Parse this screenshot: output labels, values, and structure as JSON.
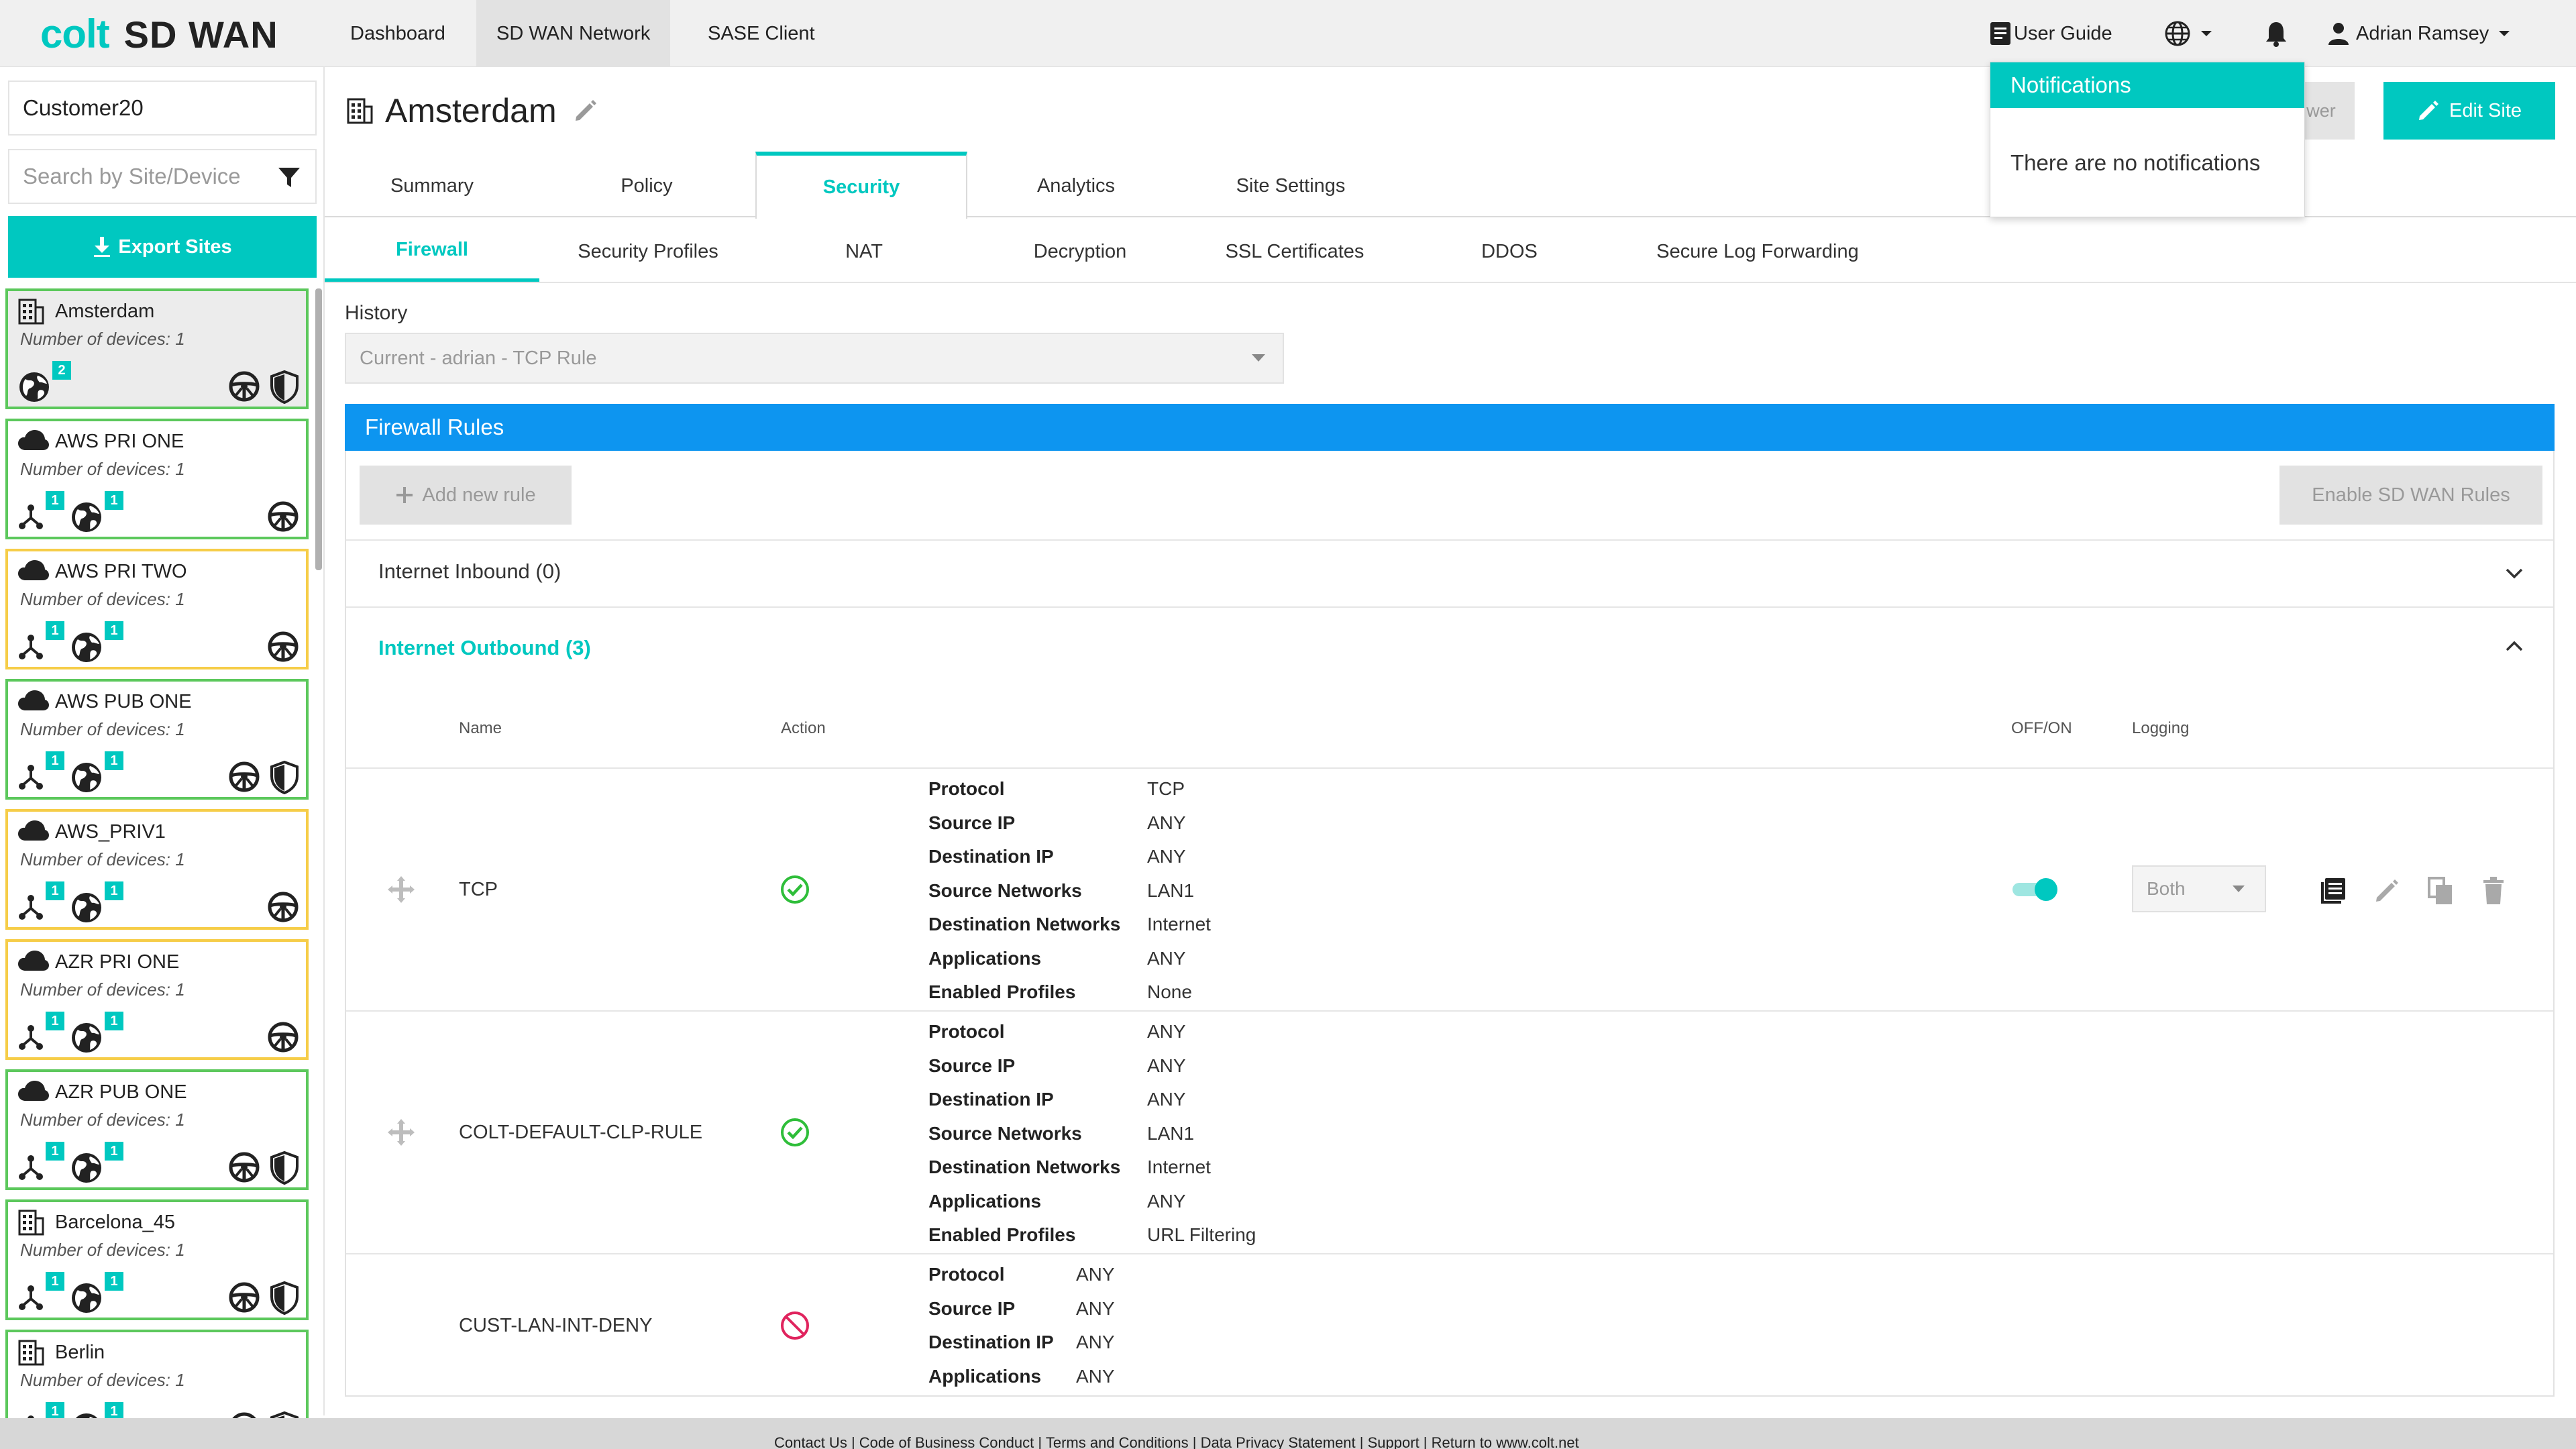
{
  "header": {
    "logo_colt": "colt",
    "logo_product": "SD WAN",
    "nav": [
      "Dashboard",
      "SD WAN Network",
      "SASE Client"
    ],
    "active_nav": "SD WAN Network",
    "user_guide": "User Guide",
    "user_name": "Adrian Ramsey"
  },
  "notifications": {
    "title": "Notifications",
    "empty": "There are no notifications"
  },
  "sidebar": {
    "customer": "Customer20",
    "search_placeholder": "Search by Site/Device",
    "export_label": "Export Sites",
    "sites": [
      {
        "name": "Amsterdam",
        "devices": "Number of devices: 1",
        "status": "green",
        "icon": "building-icon",
        "badges": [
          {
            "icon": "globe-icon",
            "count": "2"
          }
        ],
        "actions": [
          "steering-wheel-icon",
          "shield-icon"
        ],
        "selected": true
      },
      {
        "name": "AWS PRI ONE",
        "devices": "Number of devices: 1",
        "status": "green",
        "icon": "cloud-icon",
        "badges": [
          {
            "icon": "network-icon",
            "count": "1"
          },
          {
            "icon": "globe-icon",
            "count": "1"
          }
        ],
        "actions": [
          "steering-wheel-icon"
        ]
      },
      {
        "name": "AWS PRI TWO",
        "devices": "Number of devices: 1",
        "status": "yellow",
        "icon": "cloud-icon",
        "badges": [
          {
            "icon": "network-icon",
            "count": "1"
          },
          {
            "icon": "globe-icon",
            "count": "1"
          }
        ],
        "actions": [
          "steering-wheel-icon"
        ]
      },
      {
        "name": "AWS PUB ONE",
        "devices": "Number of devices: 1",
        "status": "green",
        "icon": "cloud-icon",
        "badges": [
          {
            "icon": "network-icon",
            "count": "1"
          },
          {
            "icon": "globe-icon",
            "count": "1"
          }
        ],
        "actions": [
          "steering-wheel-icon",
          "shield-icon"
        ]
      },
      {
        "name": "AWS_PRIV1",
        "devices": "Number of devices: 1",
        "status": "yellow",
        "icon": "cloud-icon",
        "badges": [
          {
            "icon": "network-icon",
            "count": "1"
          },
          {
            "icon": "globe-icon",
            "count": "1"
          }
        ],
        "actions": [
          "steering-wheel-icon"
        ]
      },
      {
        "name": "AZR PRI ONE",
        "devices": "Number of devices: 1",
        "status": "yellow",
        "icon": "cloud-icon",
        "badges": [
          {
            "icon": "network-icon",
            "count": "1"
          },
          {
            "icon": "globe-icon",
            "count": "1"
          }
        ],
        "actions": [
          "steering-wheel-icon"
        ]
      },
      {
        "name": "AZR PUB ONE",
        "devices": "Number of devices: 1",
        "status": "green",
        "icon": "cloud-icon",
        "badges": [
          {
            "icon": "network-icon",
            "count": "1"
          },
          {
            "icon": "globe-icon",
            "count": "1"
          }
        ],
        "actions": [
          "steering-wheel-icon",
          "shield-icon"
        ]
      },
      {
        "name": "Barcelona_45",
        "devices": "Number of devices: 1",
        "status": "green",
        "icon": "building-icon",
        "badges": [
          {
            "icon": "network-icon",
            "count": "1"
          },
          {
            "icon": "globe-icon",
            "count": "1"
          }
        ],
        "actions": [
          "steering-wheel-icon",
          "shield-icon"
        ]
      },
      {
        "name": "Berlin",
        "devices": "Number of devices: 1",
        "status": "green",
        "icon": "building-icon",
        "badges": [
          {
            "icon": "network-icon",
            "count": "1"
          },
          {
            "icon": "globe-icon",
            "count": "1"
          }
        ],
        "actions": [
          "steering-wheel-icon",
          "shield-icon"
        ]
      }
    ]
  },
  "page": {
    "title": "Amsterdam",
    "hidden_button_fragment": "wer",
    "edit_site": "Edit Site",
    "tabs": [
      "Summary",
      "Policy",
      "Security",
      "Analytics",
      "Site Settings"
    ],
    "active_tab": "Security",
    "subtabs": [
      "Firewall",
      "Security Profiles",
      "NAT",
      "Decryption",
      "SSL Certificates",
      "DDOS",
      "Secure Log Forwarding"
    ],
    "active_subtab": "Firewall"
  },
  "history": {
    "label": "History",
    "value": "Current - adrian - TCP Rule"
  },
  "firewall": {
    "title": "Firewall Rules",
    "add_rule": "Add new rule",
    "enable_sdwan": "Enable SD WAN Rules",
    "inbound": "Internet Inbound (0)",
    "outbound": "Internet Outbound (3)",
    "columns": {
      "name": "Name",
      "action": "Action",
      "onoff": "OFF/ON",
      "logging": "Logging"
    },
    "rules": [
      {
        "name": "TCP",
        "action": "allow",
        "enabled": true,
        "logging": "Both",
        "details": [
          {
            "k": "Protocol",
            "v": "TCP"
          },
          {
            "k": "Source IP",
            "v": "ANY"
          },
          {
            "k": "Destination IP",
            "v": "ANY"
          },
          {
            "k": "Source Networks",
            "v": "LAN1"
          },
          {
            "k": "Destination Networks",
            "v": "Internet"
          },
          {
            "k": "Applications",
            "v": "ANY"
          },
          {
            "k": "Enabled Profiles",
            "v": "None"
          }
        ]
      },
      {
        "name": "COLT-DEFAULT-CLP-RULE",
        "action": "allow",
        "details": [
          {
            "k": "Protocol",
            "v": "ANY"
          },
          {
            "k": "Source IP",
            "v": "ANY"
          },
          {
            "k": "Destination IP",
            "v": "ANY"
          },
          {
            "k": "Source Networks",
            "v": "LAN1"
          },
          {
            "k": "Destination Networks",
            "v": "Internet"
          },
          {
            "k": "Applications",
            "v": "ANY"
          },
          {
            "k": "Enabled Profiles",
            "v": "URL Filtering"
          }
        ]
      },
      {
        "name": "CUST-LAN-INT-DENY",
        "action": "deny",
        "details": [
          {
            "k": "Protocol",
            "v": "ANY"
          },
          {
            "k": "Source IP",
            "v": "ANY"
          },
          {
            "k": "Destination IP",
            "v": "ANY"
          },
          {
            "k": "Applications",
            "v": "ANY"
          }
        ]
      }
    ]
  },
  "footer": {
    "links": [
      "Contact Us",
      "Code of Business Conduct",
      "Terms and Conditions",
      "Data Privacy Statement",
      "Support",
      "Return to www.colt.net"
    ]
  },
  "colors": {
    "accent": "#00c8c0",
    "fw_bar": "#0d95f0",
    "status_green": "#5cc85c",
    "status_yellow": "#f6cd48",
    "allow": "#2fbe3a",
    "deny": "#e0245e"
  }
}
